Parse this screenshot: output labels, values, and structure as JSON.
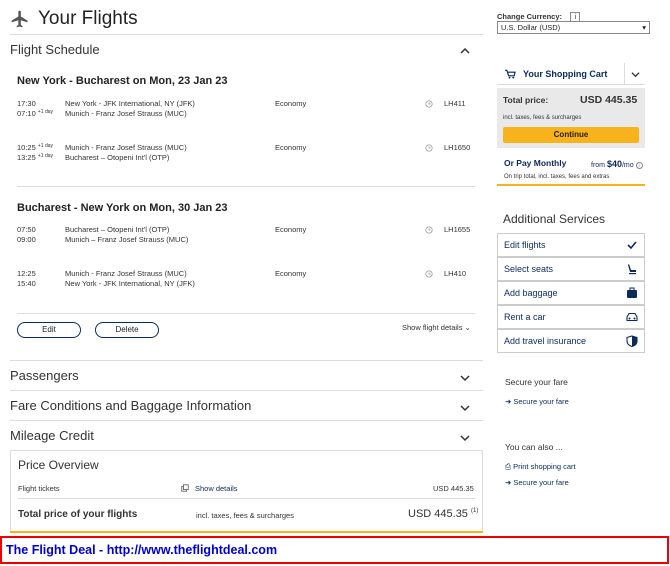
{
  "header": {
    "title": "Your Flights"
  },
  "flight_schedule": {
    "title": "Flight Schedule",
    "routes": [
      {
        "title": "New York - Bucharest on Mon, 23 Jan 23",
        "segments": [
          {
            "dep_time": "17:30",
            "arr_time": "07:10",
            "arr_day": "+1 day",
            "from": "New York - JFK International, NY (JFK)",
            "to": "Munich - Franz Josef Strauss (MUC)",
            "cabin": "Economy",
            "flight_no": "LH411"
          },
          {
            "dep_time": "10:25",
            "dep_day": "+1 day",
            "arr_time": "13:25",
            "arr_day": "+1 day",
            "from": "Munich - Franz Josef Strauss (MUC)",
            "to": "Bucharest – Otopeni Int'l (OTP)",
            "cabin": "Economy",
            "flight_no": "LH1650"
          }
        ]
      },
      {
        "title": "Bucharest - New York on Mon, 30 Jan 23",
        "segments": [
          {
            "dep_time": "07:50",
            "arr_time": "09:00",
            "from": "Bucharest – Otopeni Int'l (OTP)",
            "to": "Munich – Franz Josef Strauss (MUC)",
            "cabin": "Economy",
            "flight_no": "LH1655"
          },
          {
            "dep_time": "12:25",
            "arr_time": "15:40",
            "from": "Munich - Franz Josef Strauss (MUC)",
            "to": "New York - JFK International, NY (JFK)",
            "cabin": "Economy",
            "flight_no": "LH410"
          }
        ]
      }
    ],
    "edit_label": "Edit",
    "delete_label": "Delete",
    "show_details_label": "Show flight details"
  },
  "sections": {
    "passengers": "Passengers",
    "fare_conditions": "Fare Conditions and Baggage Information",
    "mileage": "Mileage Credit"
  },
  "price_overview": {
    "title": "Price Overview",
    "tickets_label": "Flight tickets",
    "show_details": "Show details",
    "tickets_value": "USD 445.35",
    "total_label": "Total price of your flights",
    "incl_text": "incl. taxes, fees & surcharges",
    "total_value": "USD 445.35",
    "footnote": "(1)"
  },
  "currency": {
    "label": "Change Currency:",
    "info": "i",
    "selected": "U.S. Dollar (USD)"
  },
  "cart": {
    "title": "Your Shopping Cart",
    "total_label": "Total price:",
    "total_value": "USD 445.35",
    "incl_text": "incl. taxes, fees & surcharges",
    "continue_label": "Continue",
    "pay_monthly_label": "Or Pay Monthly",
    "from_label": "from",
    "monthly_amount": "$40",
    "per_month": "/mo",
    "monthly_note": "On trip total, incl. taxes, fees and extras"
  },
  "additional_services": {
    "title": "Additional Services",
    "items": [
      {
        "label": "Edit flights",
        "icon": "check-icon"
      },
      {
        "label": "Select seats",
        "icon": "seat-icon"
      },
      {
        "label": "Add baggage",
        "icon": "baggage-icon"
      },
      {
        "label": "Rent a car",
        "icon": "car-icon"
      },
      {
        "label": "Add travel insurance",
        "icon": "shield-icon"
      }
    ]
  },
  "secure_fare": {
    "title": "Secure your fare",
    "link": "Secure your fare"
  },
  "also": {
    "title": "You can also ...",
    "print_link": "Print shopping cart",
    "secure_link": "Secure your fare"
  },
  "footer": {
    "text": "The Flight Deal - http://www.theflightdeal.com"
  },
  "colors": {
    "accent": "#f7b21c",
    "brand": "#0b2a5b",
    "footer_border": "#e00000",
    "footer_text": "#0000cc"
  }
}
